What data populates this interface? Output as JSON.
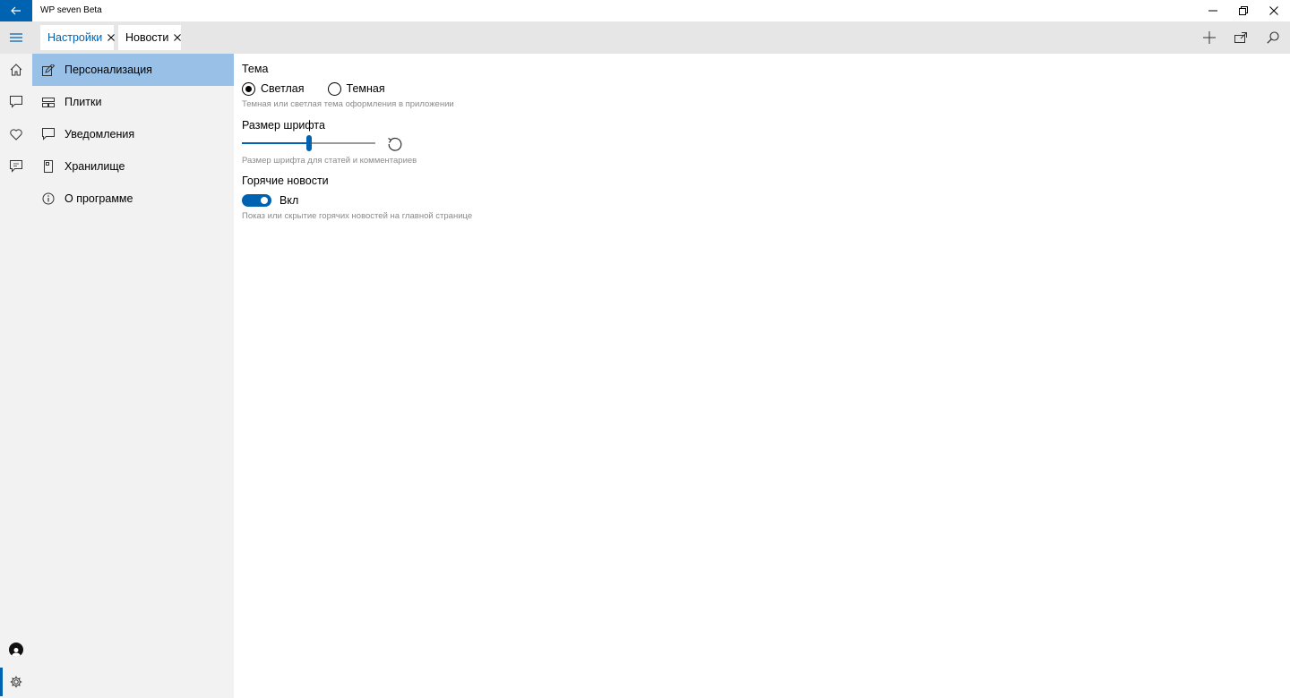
{
  "window": {
    "title": "WP seven Beta"
  },
  "tabs": [
    {
      "label": "Настройки",
      "active": true
    },
    {
      "label": "Новости",
      "active": false
    }
  ],
  "settings_nav": [
    {
      "label": "Персонализация",
      "icon": "edit-icon",
      "selected": true
    },
    {
      "label": "Плитки",
      "icon": "tiles-icon",
      "selected": false
    },
    {
      "label": "Уведомления",
      "icon": "notification-icon",
      "selected": false
    },
    {
      "label": "Хранилище",
      "icon": "storage-icon",
      "selected": false
    },
    {
      "label": "О программе",
      "icon": "info-icon",
      "selected": false
    }
  ],
  "personalization": {
    "theme": {
      "title": "Тема",
      "options": [
        "Светлая",
        "Темная"
      ],
      "selected": "Светлая",
      "hint": "Темная или светлая тема оформления в приложении"
    },
    "font_size": {
      "title": "Размер шрифта",
      "value_fraction": 0.5,
      "hint": "Размер шрифта для статей и комментариев"
    },
    "hot_news": {
      "title": "Горячие новости",
      "state_label": "Вкл",
      "enabled": true,
      "hint": "Показ или скрытие горячих новостей на главной странице"
    }
  },
  "colors": {
    "accent": "#0063b1",
    "nav_selected": "#99c0e6",
    "pane_bg": "#f2f2f2",
    "tabbar_bg": "#e6e6e6",
    "hint_text": "#8a8a8a"
  }
}
